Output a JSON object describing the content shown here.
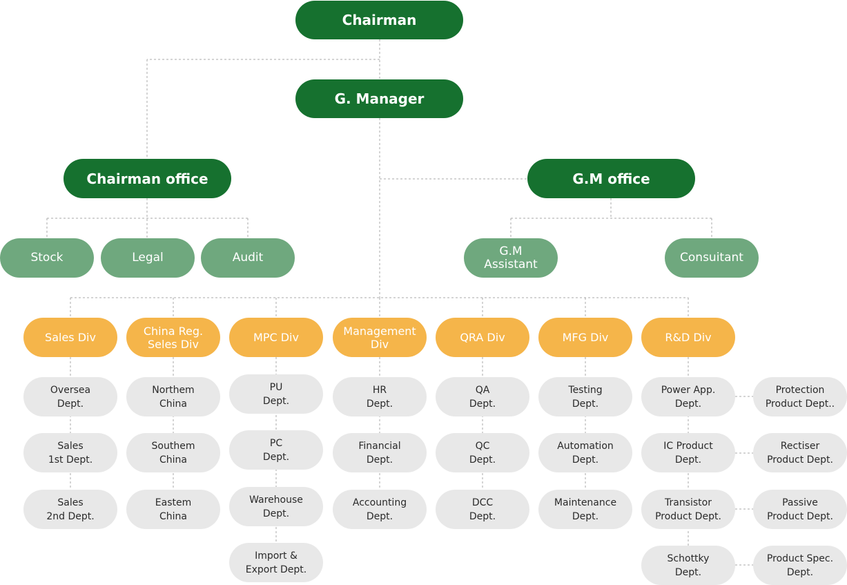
{
  "colors": {
    "executive": "#16712f",
    "office_staff": "#6fa87e",
    "division": "#f5b54a",
    "department": "#e8e8e8",
    "connector": "#a9a9a9"
  },
  "executives": {
    "chairman": "Chairman",
    "general_manager": "G. Manager",
    "chairman_office": "Chairman office",
    "gm_office": "G.M office"
  },
  "chairman_office_units": [
    "Stock",
    "Legal",
    "Audit"
  ],
  "gm_office_units": [
    "G.M\nAssistant",
    "Consuitant"
  ],
  "divisions": [
    {
      "name": "Sales Div",
      "departments": [
        "Oversea\nDept.",
        "Sales\n1st Dept.",
        "Sales\n2nd Dept."
      ]
    },
    {
      "name": "China Reg.\nSeles Div",
      "departments": [
        "Northem\nChina",
        "Southem\nChina",
        "Eastem\nChina"
      ]
    },
    {
      "name": "MPC Div",
      "departments": [
        "PU\nDept.",
        "PC\nDept.",
        "Warehouse\nDept.",
        "Import &\nExport Dept."
      ]
    },
    {
      "name": "Management\nDiv",
      "departments": [
        "HR\nDept.",
        "Financial\nDept.",
        "Accounting\nDept."
      ]
    },
    {
      "name": "QRA Div",
      "departments": [
        "QA\nDept.",
        "QC\nDept.",
        "DCC\nDept."
      ]
    },
    {
      "name": "MFG Div",
      "departments": [
        "Testing\nDept.",
        "Automation\nDept.",
        "Maintenance\nDept."
      ]
    },
    {
      "name": "R&D Div",
      "departments": [
        "Power App.\nDept.",
        "IC Product\nDept.",
        "Transistor\nProduct Dept.",
        "Schottky\nDept."
      ]
    }
  ],
  "rnd_sub_departments": [
    "Protection\nProduct Dept..",
    "Rectiser\nProduct Dept.",
    "Passive\nProduct Dept.",
    "Product Spec.\nDept."
  ]
}
